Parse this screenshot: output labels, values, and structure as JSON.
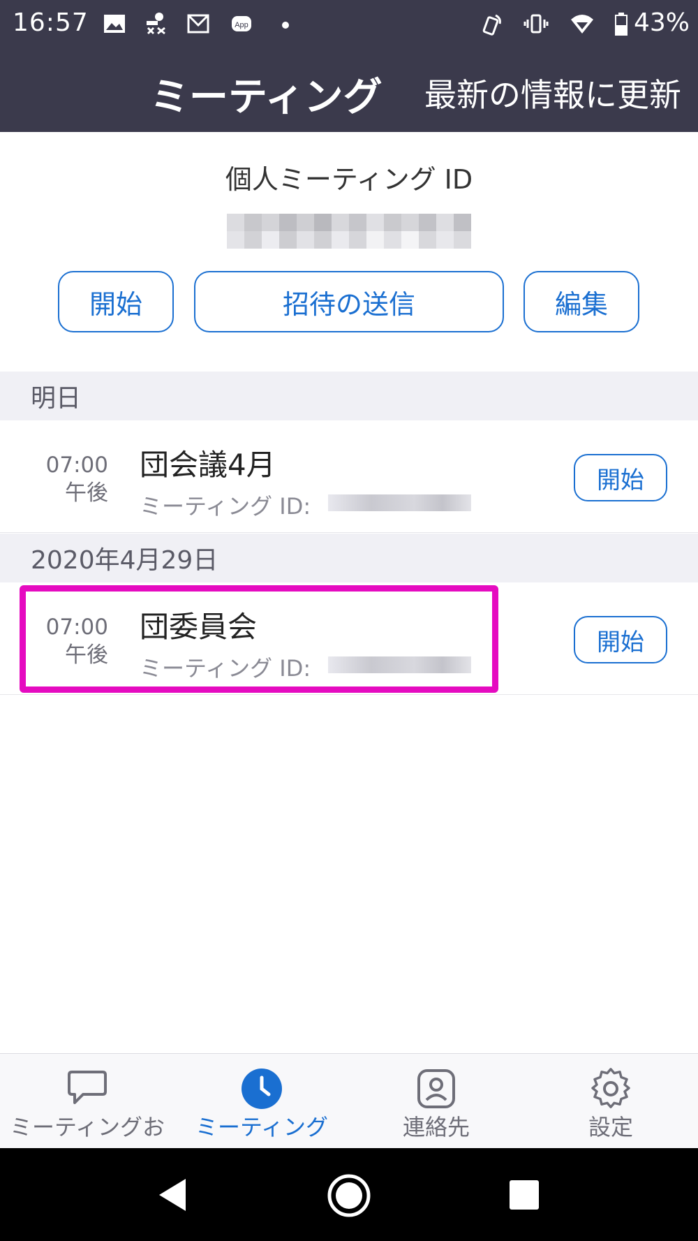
{
  "status_bar": {
    "time": "16:57",
    "battery": "43%",
    "icons": [
      "image-icon",
      "notification-icon",
      "gmail-icon",
      "app-icon",
      "dot-icon",
      "nfc-icon",
      "vibrate-icon",
      "wifi-icon",
      "battery-icon"
    ]
  },
  "header": {
    "title": "ミーティング",
    "refresh": "最新の情報に更新"
  },
  "personal_meeting": {
    "label": "個人ミーティング ID",
    "buttons": {
      "start": "開始",
      "invite": "招待の送信",
      "edit": "編集"
    }
  },
  "sections": [
    {
      "heading": "明日",
      "meetings": [
        {
          "time": "07:00",
          "ampm": "午後",
          "title": "団会議4月",
          "id_label": "ミーティング ID:",
          "button": "開始"
        }
      ]
    },
    {
      "heading": "2020年4月29日",
      "meetings": [
        {
          "time": "07:00",
          "ampm": "午後",
          "title": "団委員会",
          "id_label": "ミーティング ID:",
          "button": "開始"
        }
      ]
    }
  ],
  "bottom_nav": [
    {
      "label": "ミーティングお",
      "icon": "chat-bubble-icon",
      "active": false
    },
    {
      "label": "ミーティング",
      "icon": "clock-icon",
      "active": true
    },
    {
      "label": "連絡先",
      "icon": "contact-icon",
      "active": false
    },
    {
      "label": "設定",
      "icon": "gear-icon",
      "active": false
    }
  ],
  "colors": {
    "header_bg": "#3b3a4c",
    "accent": "#1a6fd1",
    "highlight": "#e50bc0",
    "section_bg": "#f0f0f5"
  }
}
